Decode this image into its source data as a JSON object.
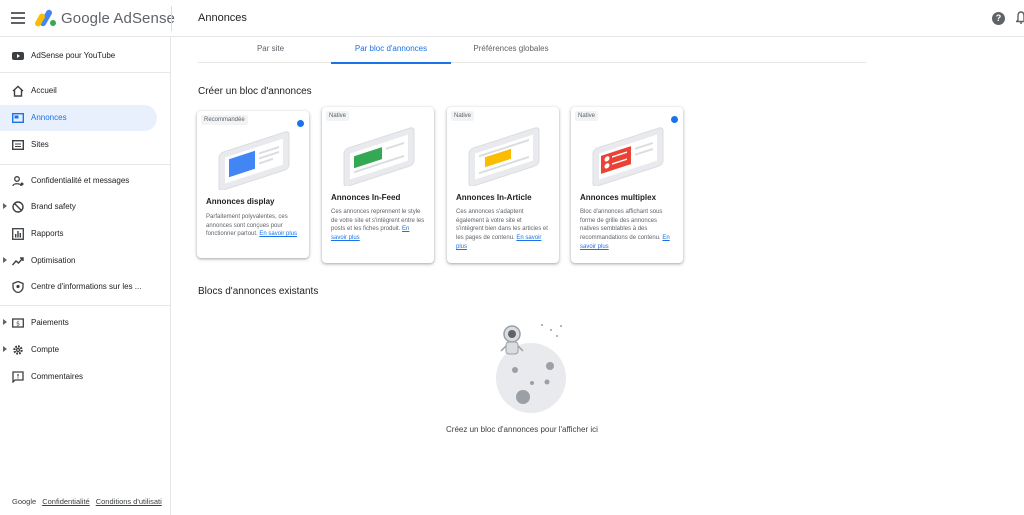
{
  "header": {
    "brand": "Google AdSense",
    "page_title": "Annonces"
  },
  "sidebar": {
    "items": [
      {
        "label": "AdSense pour YouTube"
      },
      {
        "label": "Accueil"
      },
      {
        "label": "Annonces"
      },
      {
        "label": "Sites"
      },
      {
        "label": "Confidentialité et messages"
      },
      {
        "label": "Brand safety"
      },
      {
        "label": "Rapports"
      },
      {
        "label": "Optimisation"
      },
      {
        "label": "Centre d'informations sur les ..."
      },
      {
        "label": "Paiements"
      },
      {
        "label": "Compte"
      },
      {
        "label": "Commentaires"
      }
    ],
    "active": "Annonces"
  },
  "footer": {
    "google": "Google",
    "privacy": "Confidentialité",
    "terms": "Conditions d'utilisati"
  },
  "tabs": [
    {
      "label": "Par site"
    },
    {
      "label": "Par bloc d'annonces"
    },
    {
      "label": "Préférences globales"
    }
  ],
  "create": {
    "title": "Créer un bloc d'annonces",
    "cards": [
      {
        "badge": "Recommandée",
        "title": "Annonces display",
        "desc": "Parfaitement polyvalentes, ces annonces sont conçues pour fonctionner partout. ",
        "more": "En savoir plus",
        "accent": "#4285f4"
      },
      {
        "badge": "Native",
        "title": "Annonces In-Feed",
        "desc": "Ces annonces reprennent le style de votre site et s'intègrent entre les posts et les fiches produit. ",
        "more": "En savoir plus",
        "accent": "#34a853"
      },
      {
        "badge": "Native",
        "title": "Annonces In-Article",
        "desc": "Ces annonces s'adaptent également à votre site et s'intègrent bien dans les articles et les pages de contenu. ",
        "more": "En savoir plus",
        "accent": "#fbbc04"
      },
      {
        "badge": "Native",
        "title": "Annonces multiplex",
        "desc": "Bloc d'annonces affichant sous forme de grille des annonces natives semblables à des recommandations de contenu. ",
        "more": "En savoir plus",
        "accent": "#ea4335"
      }
    ]
  },
  "existing": {
    "title": "Blocs d'annonces existants",
    "empty_text": "Créez un bloc d'annonces pour l'afficher ici"
  },
  "colors": {
    "primary": "#1a73e8",
    "active_bg": "#e8f0fe"
  }
}
